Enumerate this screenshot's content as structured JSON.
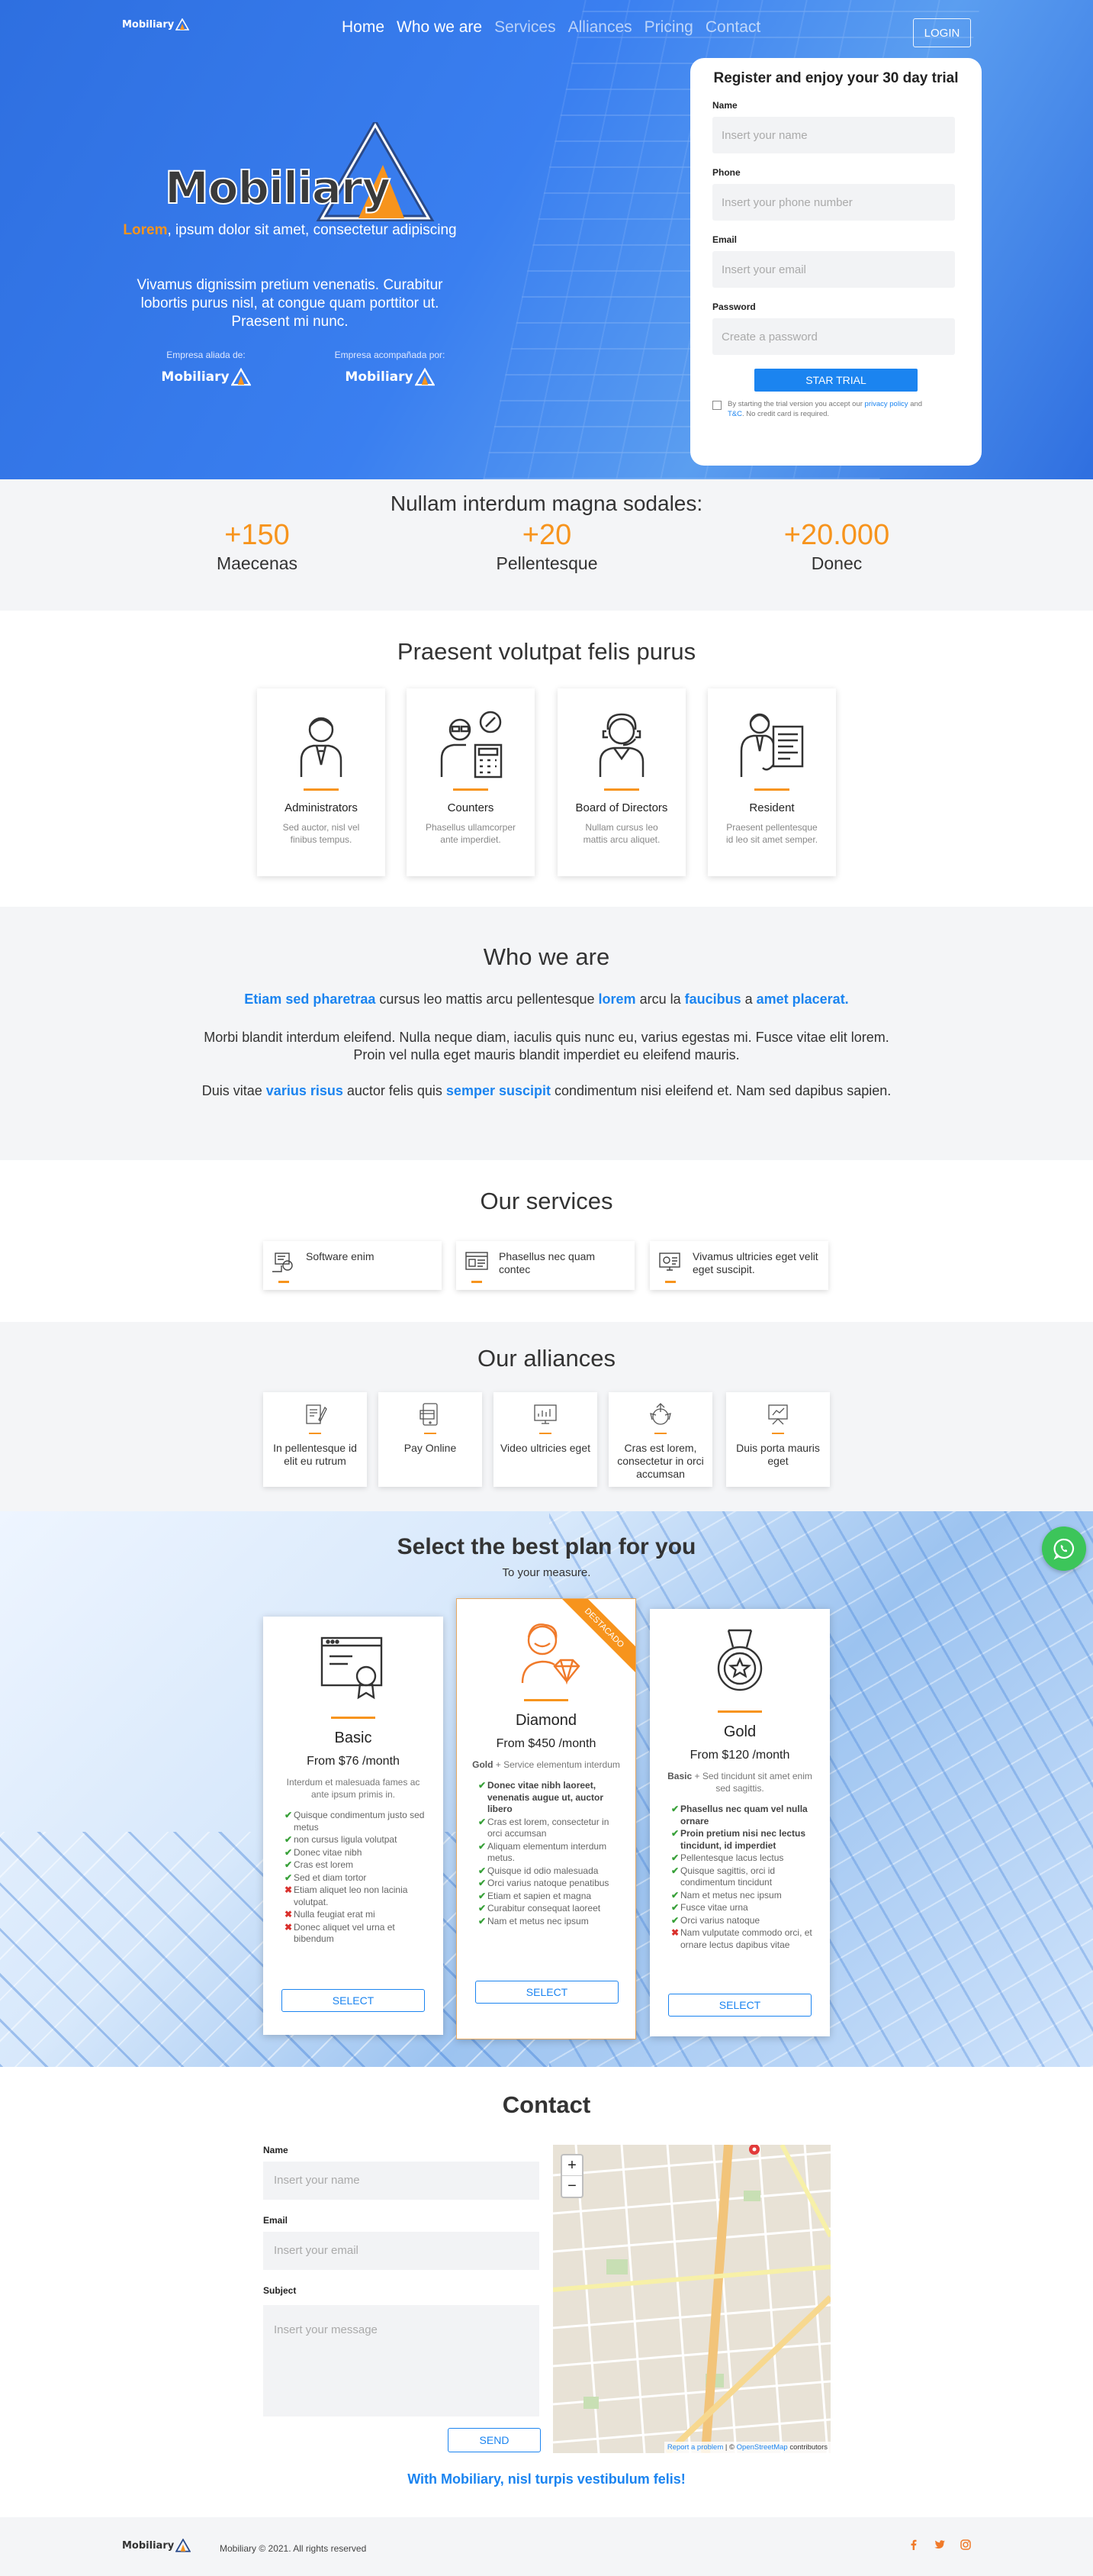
{
  "brand": {
    "name": "Mobiliary",
    "accent": "#f7941d",
    "primary": "#1b84f0"
  },
  "nav": {
    "items": [
      "Home",
      "Who we are",
      "Services",
      "Alliances",
      "Pricing",
      "Contact"
    ],
    "active": [
      "Home",
      "Who we are"
    ],
    "login": "LOGIN"
  },
  "hero": {
    "lead_highlight": "Lorem",
    "lead_rest": ", ipsum dolor sit amet, consectetur adipiscing",
    "sub": "Vivamus dignissim pretium venenatis. Curabitur lobortis purus nisl, at congue quam porttitor ut. Praesent mi nunc.",
    "partner1_label": "Empresa aliada de:",
    "partner2_label": "Empresa acompañada por:"
  },
  "register": {
    "title": "Register and enjoy your 30 day trial",
    "name_label": "Name",
    "name_placeholder": "Insert your name",
    "phone_label": "Phone",
    "phone_placeholder": "Insert your phone number",
    "email_label": "Email",
    "email_placeholder": "Insert your email",
    "password_label": "Password",
    "password_placeholder": "Create a password",
    "button": "STAR TRIAL",
    "terms_a": "By starting the trial version you accept our ",
    "terms_privacy": "privacy policy",
    "terms_and": " and ",
    "terms_tc": "T&C",
    "terms_b": ". No credit card is required."
  },
  "stats": {
    "title": "Nullam interdum magna sodales:",
    "items": [
      {
        "value": "+150",
        "label": "Maecenas"
      },
      {
        "value": "+20",
        "label": "Pellentesque"
      },
      {
        "value": "+20.000",
        "label": "Donec"
      }
    ]
  },
  "roles": {
    "title": "Praesent volutpat felis purus",
    "items": [
      {
        "name": "Administrators",
        "desc": "Sed auctor, nisl vel finibus tempus.",
        "icon": "businessman-icon"
      },
      {
        "name": "Counters",
        "desc": "Phasellus ullamcorper ante imperdiet.",
        "icon": "accountant-icon"
      },
      {
        "name": "Board of Directors",
        "desc": "Nullam cursus leo mattis arcu aliquet.",
        "icon": "director-icon"
      },
      {
        "name": "Resident",
        "desc": "Praesent pellentesque id leo sit amet semper.",
        "icon": "resident-icon"
      }
    ]
  },
  "who": {
    "title": "Who we are",
    "p1": [
      "Etiam sed pharetraa",
      " cursus leo mattis arcu pellentesque ",
      "lorem",
      " arcu la ",
      "faucibus",
      " a ",
      "amet placerat."
    ],
    "p2": "Morbi blandit interdum eleifend. Nulla neque diam, iaculis quis nunc eu, varius egestas mi. Fusce vitae elit lorem. Proin vel nulla eget mauris blandit imperdiet eu eleifend mauris.",
    "p3": [
      "Duis vitae ",
      "varius risus",
      " auctor felis quis ",
      "semper suscipit",
      " condimentum nisi eleifend et. Nam sed dapibus sapien."
    ]
  },
  "services": {
    "title": "Our services",
    "items": [
      {
        "label": "Software enim",
        "icon": "software-icon"
      },
      {
        "label": "Phasellus nec quam contec",
        "icon": "browser-icon"
      },
      {
        "label": "Vivamus ultricies eget velit eget suscipit.",
        "icon": "monitor-settings-icon"
      }
    ]
  },
  "alliances": {
    "title": "Our alliances",
    "items": [
      {
        "label": "In pellentesque id elit eu rutrum",
        "icon": "document-edit-icon"
      },
      {
        "label": "Pay Online",
        "icon": "pay-online-icon"
      },
      {
        "label": "Video ultricies eget",
        "icon": "video-chart-icon"
      },
      {
        "label": "Cras est lorem, consectetur in orci accumsan",
        "icon": "recycle-icon"
      },
      {
        "label": "Duis porta mauris eget",
        "icon": "presentation-icon"
      }
    ]
  },
  "plans": {
    "title": "Select the best plan for you",
    "subtitle": "To your measure.",
    "select_label": "SELECT",
    "featured_ribbon": "DESTACADO",
    "items": [
      {
        "name": "Basic",
        "price": "From $76 /month",
        "desc_bold": "",
        "desc": "Interdum et malesuada fames ac ante ipsum primis in.",
        "icon": "certificate-icon",
        "features": [
          {
            "t": "Quisque condimentum justo sed metus",
            "ok": true
          },
          {
            "t": "non cursus ligula volutpat",
            "ok": true
          },
          {
            "t": "Donec vitae nibh",
            "ok": true
          },
          {
            "t": "Cras est lorem",
            "ok": true
          },
          {
            "t": "Sed et diam tortor",
            "ok": true
          },
          {
            "t": "Etiam aliquet leo non lacinia volutpat.",
            "ok": false
          },
          {
            "t": "Nulla feugiat erat mi",
            "ok": false
          },
          {
            "t": "Donec aliquet vel urna et bibendum",
            "ok": false
          }
        ]
      },
      {
        "name": "Diamond",
        "price": "From $450 /month",
        "desc_bold": "Gold",
        "desc": " + Service elementum interdum",
        "icon": "diamond-person-icon",
        "features": [
          {
            "t": "Donec vitae nibh laoreet, venenatis augue ut, auctor libero",
            "ok": true,
            "bold": true
          },
          {
            "t": "Cras est lorem, consectetur in orci accumsan",
            "ok": true
          },
          {
            "t": "Aliquam elementum interdum metus.",
            "ok": true
          },
          {
            "t": "Quisque id odio malesuada",
            "ok": true
          },
          {
            "t": "Orci varius natoque penatibus",
            "ok": true
          },
          {
            "t": "Etiam et sapien et magna",
            "ok": true
          },
          {
            "t": "Curabitur consequat laoreet",
            "ok": true
          },
          {
            "t": "Nam et metus nec ipsum",
            "ok": true
          }
        ]
      },
      {
        "name": "Gold",
        "price": "From $120 /month",
        "desc_bold": "Basic",
        "desc": " + Sed tincidunt sit amet enim sed sagittis.",
        "icon": "medal-icon",
        "features": [
          {
            "t": "Phasellus nec quam vel nulla ornare",
            "ok": true,
            "bold": true
          },
          {
            "t": "Proin pretium nisi nec lectus tincidunt, id imperdiet",
            "ok": true,
            "bold": true
          },
          {
            "t": "Pellentesque lacus lectus",
            "ok": true
          },
          {
            "t": "Quisque sagittis, orci id condimentum tincidunt",
            "ok": true
          },
          {
            "t": "Nam et metus nec ipsum",
            "ok": true
          },
          {
            "t": "Fusce vitae urna",
            "ok": true
          },
          {
            "t": "Orci varius natoque",
            "ok": true
          },
          {
            "t": "Nam vulputate commodo orci, et ornare lectus dapibus vitae",
            "ok": false
          }
        ]
      }
    ]
  },
  "contact": {
    "title": "Contact",
    "name_label": "Name",
    "name_placeholder": "Insert your name",
    "email_label": "Email",
    "email_placeholder": "Insert your email",
    "subject_label": "Subject",
    "subject_placeholder": "Insert your message",
    "send": "SEND",
    "map_zoom_in": "+",
    "map_zoom_out": "−",
    "map_report": "Report a problem",
    "map_attr_sep": " | © ",
    "map_osm": "OpenStreetMap",
    "map_attr_end": " contributors",
    "tagline": "With Mobiliary, nisl turpis vestibulum felis!"
  },
  "footer": {
    "copyright": "Mobiliary © 2021. All rights reserved",
    "social": [
      "facebook-icon",
      "twitter-icon",
      "instagram-icon"
    ]
  }
}
